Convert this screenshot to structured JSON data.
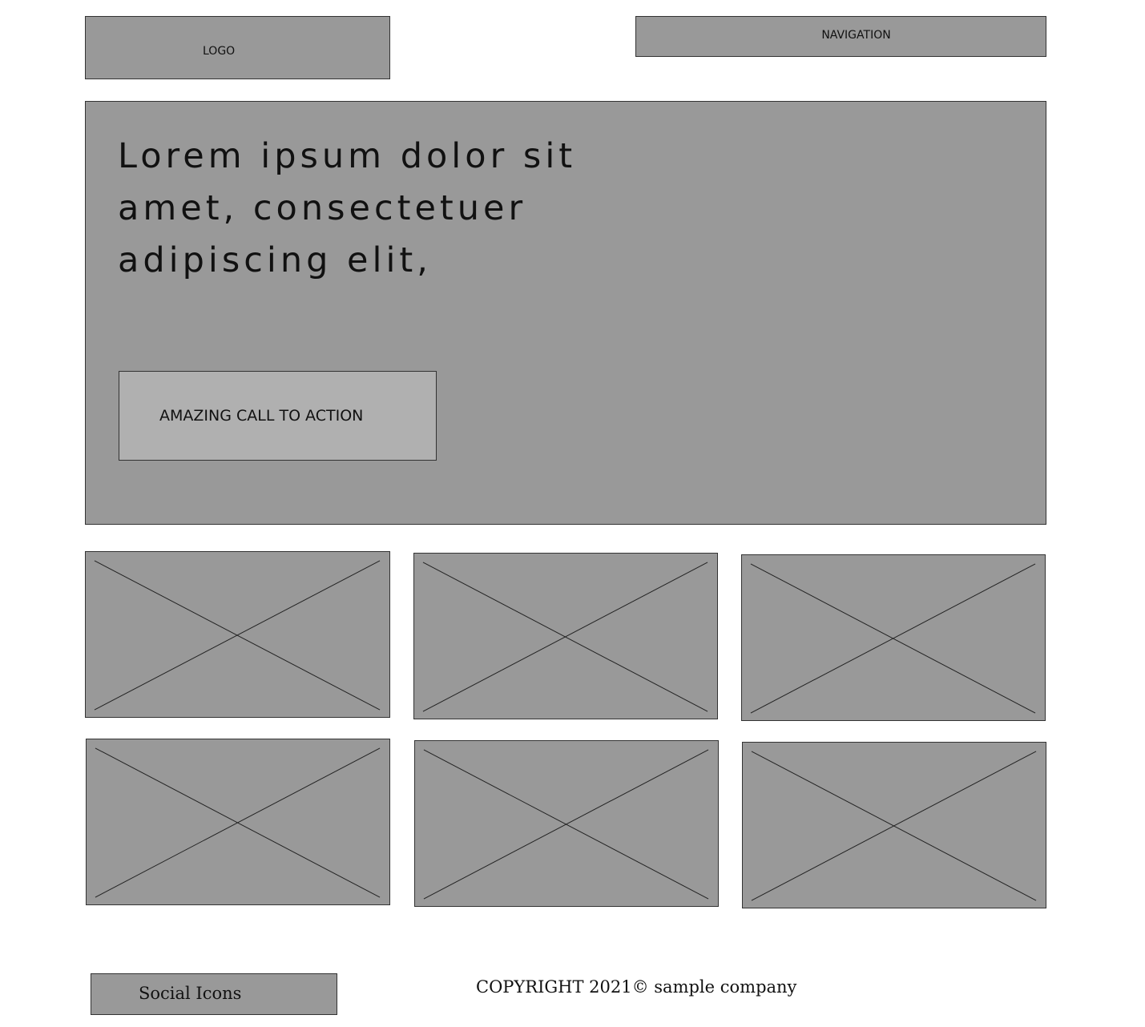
{
  "header": {
    "logo_label": "LOGO",
    "nav_label": "NAVIGATION"
  },
  "hero": {
    "heading": "Lorem ipsum dolor sit amet, consectetuer adipiscing elit,",
    "cta_label": "AMAZING CALL TO ACTION"
  },
  "gallery": {
    "tile_count": 6
  },
  "footer": {
    "social_label": "Social Icons",
    "copyright": "COPYRIGHT 2021© sample company"
  },
  "colors": {
    "placeholder_fill": "#999999",
    "cta_fill": "#b0b0b0",
    "outline": "#333333",
    "background": "#ffffff"
  }
}
